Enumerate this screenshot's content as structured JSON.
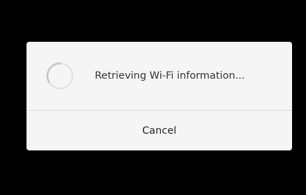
{
  "dialog": {
    "message": "Retrieving Wi-Fi information...",
    "cancel_label": "Cancel",
    "spinner_icon": "loading-spinner-icon"
  },
  "colors": {
    "background": "#000000",
    "dialog_background": "#f5f5f5",
    "text": "#333333",
    "divider": "#d9d9d9"
  }
}
